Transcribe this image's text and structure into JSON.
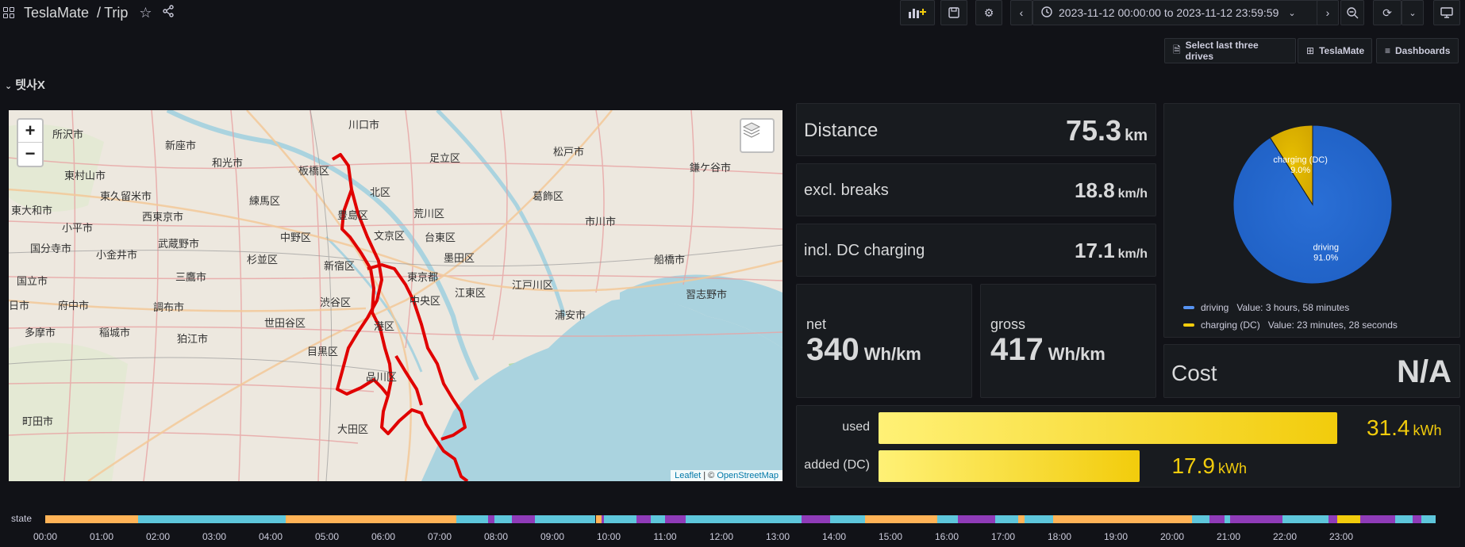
{
  "topbar": {
    "app": "TeslaMate",
    "separator": "/",
    "page": "Trip",
    "time_range": "2023-11-12 00:00:00 to 2023-11-12 23:59:59"
  },
  "links": {
    "last_drives": "Select last three drives",
    "teslamate": "TeslaMate",
    "dashboards": "Dashboards"
  },
  "row_title": "텟사X",
  "map": {
    "attribution_leaflet": "Leaflet",
    "attribution_sep": " | © ",
    "attribution_osm": "OpenStreetMap",
    "zoom_in": "+",
    "zoom_out": "−",
    "labels": [
      {
        "text": "所沢市"
      },
      {
        "text": "新座市"
      },
      {
        "text": "和光市"
      },
      {
        "text": "川口市"
      },
      {
        "text": "足立区"
      },
      {
        "text": "松戸市"
      },
      {
        "text": "鎌ケ谷市"
      },
      {
        "text": "東村山市"
      },
      {
        "text": "板橋区"
      },
      {
        "text": "北区"
      },
      {
        "text": "葛飾区"
      },
      {
        "text": "東久留米市"
      },
      {
        "text": "練馬区"
      },
      {
        "text": "東大和市"
      },
      {
        "text": "西東京市"
      },
      {
        "text": "豊島区"
      },
      {
        "text": "荒川区"
      },
      {
        "text": "市川市"
      },
      {
        "text": "小平市"
      },
      {
        "text": "中野区"
      },
      {
        "text": "文京区"
      },
      {
        "text": "台東区"
      },
      {
        "text": "武蔵野市"
      },
      {
        "text": "国分寺市"
      },
      {
        "text": "小金井市"
      },
      {
        "text": "杉並区"
      },
      {
        "text": "墨田区"
      },
      {
        "text": "船橋市"
      },
      {
        "text": "新宿区"
      },
      {
        "text": "国立市"
      },
      {
        "text": "三鷹市"
      },
      {
        "text": "東京都"
      },
      {
        "text": "江戸川区"
      },
      {
        "text": "江東区"
      },
      {
        "text": "中央区"
      },
      {
        "text": "渋谷区"
      },
      {
        "text": "府中市"
      },
      {
        "text": "調布市"
      },
      {
        "text": "習志野市"
      },
      {
        "text": "浦安市"
      },
      {
        "text": "世田谷区"
      },
      {
        "text": "港区"
      },
      {
        "text": "多摩市"
      },
      {
        "text": "稲城市"
      },
      {
        "text": "狛江市"
      },
      {
        "text": "目黒区"
      },
      {
        "text": "品川区"
      },
      {
        "text": "町田市"
      },
      {
        "text": "大田区"
      },
      {
        "text": "日市"
      }
    ]
  },
  "stats": {
    "distance": {
      "title": "Distance",
      "value": "75.3",
      "unit": "km"
    },
    "excl_breaks": {
      "title": "excl. breaks",
      "value": "18.8",
      "unit": "km/h"
    },
    "incl_dc": {
      "title": "incl. DC charging",
      "value": "17.1",
      "unit": "km/h"
    },
    "net": {
      "title": "net",
      "value": "340",
      "unit": "Wh/km"
    },
    "gross": {
      "title": "gross",
      "value": "417",
      "unit": "Wh/km"
    },
    "cost": {
      "title": "Cost",
      "value": "N/A"
    }
  },
  "pie": {
    "slices": [
      {
        "name": "driving",
        "percent": 91.0,
        "percent_label": "91.0%",
        "color": "#1f60c4",
        "value": "Value: 3 hours, 58 minutes"
      },
      {
        "name": "charging (DC)",
        "percent": 9.0,
        "percent_label": "9.0%",
        "color": "#e0b400",
        "value": "Value: 23 minutes, 28 seconds"
      }
    ]
  },
  "bars": {
    "used": {
      "label": "used",
      "value": "31.4",
      "unit": "kWh",
      "fraction": 1.0
    },
    "added": {
      "label": "added (DC)",
      "value": "17.9",
      "unit": "kWh",
      "fraction": 0.57
    }
  },
  "timeline": {
    "label": "state",
    "colors": {
      "asleep": "#ffb357",
      "online": "#5ec6db",
      "driving": "#8f3bb8",
      "charging": "#f2cc0c"
    },
    "ticks": [
      "00:00",
      "01:00",
      "02:00",
      "03:00",
      "04:00",
      "05:00",
      "06:00",
      "07:00",
      "08:00",
      "09:00",
      "10:00",
      "11:00",
      "12:00",
      "13:00",
      "14:00",
      "15:00",
      "16:00",
      "17:00",
      "18:00",
      "19:00",
      "20:00",
      "21:00",
      "22:00",
      "23:00"
    ]
  }
}
